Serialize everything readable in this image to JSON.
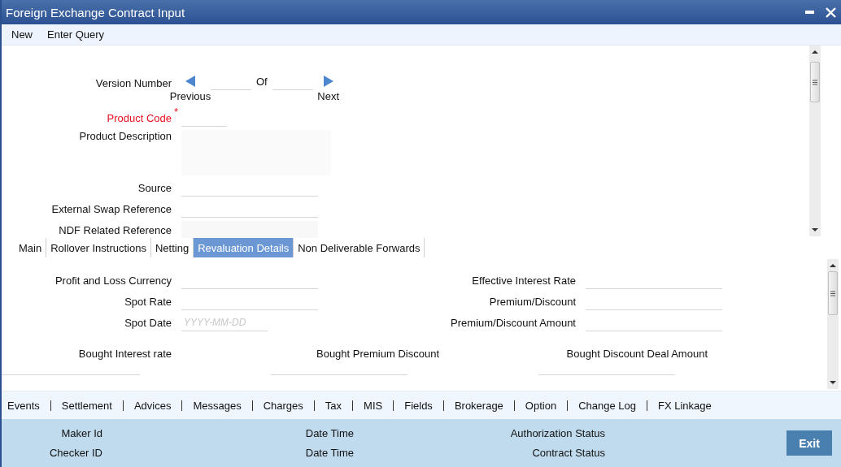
{
  "window": {
    "title": "Foreign Exchange Contract Input"
  },
  "menu": [
    {
      "label": "New"
    },
    {
      "label": "Enter Query"
    }
  ],
  "version": {
    "label": "Version Number",
    "of": "Of",
    "previous": "Previous",
    "next": "Next"
  },
  "header_fields": [
    {
      "label": "Product Code",
      "kind": "code",
      "required_mark": "*"
    },
    {
      "label": "Product Description",
      "kind": "textarea"
    },
    {
      "label": "Source",
      "kind": "text"
    },
    {
      "label": "External Swap Reference",
      "kind": "text"
    },
    {
      "label": "NDF Related Reference",
      "kind": "readonly"
    }
  ],
  "tabs": [
    {
      "label": "Main",
      "selected": false
    },
    {
      "label": "Rollover Instructions",
      "selected": false
    },
    {
      "label": "Netting",
      "selected": false
    },
    {
      "label": "Revaluation Details",
      "selected": true
    },
    {
      "label": "Non Deliverable Forwards",
      "selected": false
    }
  ],
  "revaluation": {
    "left_fields": [
      {
        "label": "Profit and Loss Currency"
      },
      {
        "label": "Spot Rate"
      },
      {
        "label": "Spot Date",
        "placeholder": "YYYY-MM-DD"
      }
    ],
    "right_fields": [
      {
        "label": "Effective Interest Rate"
      },
      {
        "label": "Premium/Discount"
      },
      {
        "label": "Premium/Discount Amount"
      }
    ],
    "bought_labels": [
      "Bought Interest rate",
      "Bought Premium Discount",
      "Bought Discount Deal Amount"
    ]
  },
  "toolbar": [
    "Events",
    "Settlement",
    "Advices",
    "Messages",
    "Charges",
    "Tax",
    "MIS",
    "Fields",
    "Brokerage",
    "Option",
    "Change Log",
    "FX Linkage"
  ],
  "footer": {
    "rows": [
      [
        "Maker Id",
        "Date Time",
        "Authorization Status"
      ],
      [
        "Checker ID",
        "Date Time",
        "Contract Status"
      ]
    ],
    "exit": "Exit"
  }
}
